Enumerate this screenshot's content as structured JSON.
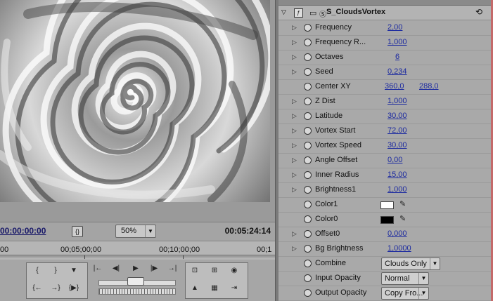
{
  "program_monitor": {
    "current_timecode": "00:00:00:00",
    "duration_timecode": "00:05:24:14",
    "zoom": "50%",
    "ruler": [
      "00",
      "00;05;00;00",
      "00;10;00;00",
      "00;1"
    ]
  },
  "effect_controls": {
    "effect_name": "S_CloudsVortex",
    "params": [
      {
        "label": "Frequency",
        "value": "2,00",
        "has_twirl": true
      },
      {
        "label": "Frequency R...",
        "value": "1,000",
        "has_twirl": true
      },
      {
        "label": "Octaves",
        "value": "6",
        "has_twirl": true
      },
      {
        "label": "Seed",
        "value": "0,234",
        "has_twirl": true
      },
      {
        "label": "Center XY",
        "value": "360,0",
        "value2": "288,0",
        "has_twirl": false
      },
      {
        "label": "Z Dist",
        "value": "1,000",
        "has_twirl": true
      },
      {
        "label": "Latitude",
        "value": "30,00",
        "has_twirl": true
      },
      {
        "label": "Vortex Start",
        "value": "72,00",
        "has_twirl": true
      },
      {
        "label": "Vortex Speed",
        "value": "30,00",
        "has_twirl": true
      },
      {
        "label": "Angle Offset",
        "value": "0,00",
        "has_twirl": true
      },
      {
        "label": "Inner Radius",
        "value": "15,00",
        "has_twirl": true
      },
      {
        "label": "Brightness1",
        "value": "1,000",
        "has_twirl": true
      },
      {
        "label": "Color1",
        "type": "color",
        "color": "#ffffff",
        "has_twirl": false
      },
      {
        "label": "Color0",
        "type": "color",
        "color": "#000000",
        "has_twirl": false
      },
      {
        "label": "Offset0",
        "value": "0,000",
        "has_twirl": true
      },
      {
        "label": "Bg Brightness",
        "value": "1,0000",
        "has_twirl": true
      },
      {
        "label": "Combine",
        "type": "dropdown",
        "value": "Clouds Only",
        "has_twirl": false
      },
      {
        "label": "Input Opacity",
        "type": "dropdown",
        "value": "Normal",
        "has_twirl": false
      },
      {
        "label": "Output Opacity",
        "type": "dropdown",
        "value": "Copy Fro...",
        "has_twirl": false
      }
    ]
  }
}
